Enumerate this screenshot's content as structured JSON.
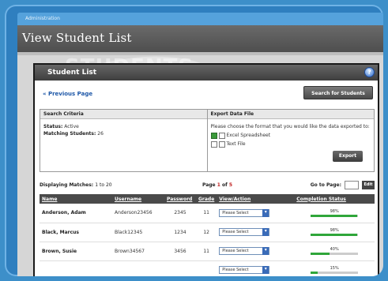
{
  "admin_label": "Administration",
  "page_title": "View Student List",
  "bg_word": "STUDENTS",
  "panel_title": "Student List",
  "previous_page": "« Previous Page",
  "search_button": "Search for Students",
  "criteria": {
    "heading": "Search Criteria",
    "status_label": "Status:",
    "status_value": "Active",
    "matching_label": "Matching Students:",
    "matching_value": "26"
  },
  "export": {
    "heading": "Export Data File",
    "instructions": "Please choose the format that you would like the data exported to:",
    "option_excel": "Excel Spreadsheet",
    "option_text": "Text File",
    "button": "Export"
  },
  "pager": {
    "displaying_label": "Displaying Matches:",
    "displaying_value": "1 to 20",
    "page_label": "Page",
    "page_current": "1",
    "page_of": "of",
    "page_total": "5",
    "go_to_label": "Go to Page:",
    "go_button": "Edit"
  },
  "table": {
    "headers": [
      "Name",
      "Username",
      "Password",
      "Grade",
      "View/Action",
      "Completion Status"
    ],
    "rows": [
      {
        "name": "Anderson, Adam",
        "username": "Anderson23456",
        "password": "2345",
        "grade": "11",
        "action": "Please Select",
        "status": "98%",
        "progress": 0.98
      },
      {
        "name": "Black, Marcus",
        "username": "Black12345",
        "password": "1234",
        "grade": "12",
        "action": "Please Select",
        "status": "98%",
        "progress": 0.98
      },
      {
        "name": "Brown, Susie",
        "username": "Brown34567",
        "password": "3456",
        "grade": "11",
        "action": "Please Select",
        "status": "40%",
        "progress": 0.4
      },
      {
        "name": "",
        "username": "",
        "password": "",
        "grade": "",
        "action": "Please Select",
        "status": "15%",
        "progress": 0.15
      }
    ]
  }
}
